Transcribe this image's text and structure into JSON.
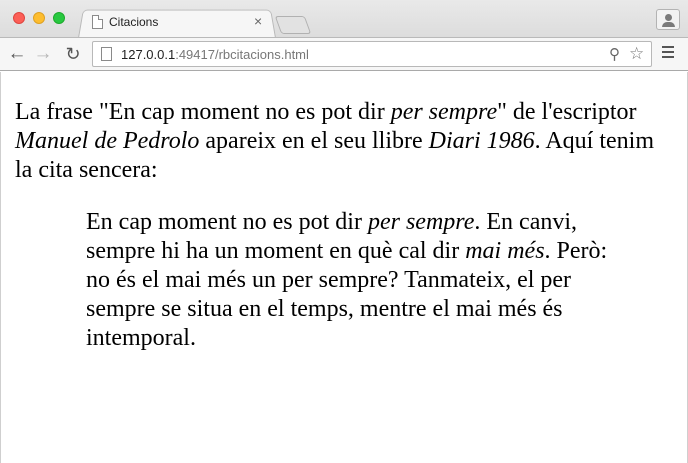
{
  "window": {
    "tab_title": "Citacions",
    "tab_close": "×"
  },
  "toolbar": {
    "back": "←",
    "forward": "→",
    "reload": "↻",
    "url_host": "127.0.0.1",
    "url_rest": ":49417/rbcitacions.html",
    "zoom_icon": "⚲",
    "star_icon": "☆"
  },
  "page": {
    "intro": {
      "part1": "La frase \"En cap moment no es pot dir ",
      "em1": "per sempre",
      "part2": "\" de l'escriptor ",
      "em2": "Manuel de Pedrolo",
      "part3": " apareix en el seu llibre ",
      "em3": "Diari 1986",
      "part4": ". Aquí tenim la cita sencera:"
    },
    "quote": {
      "part1": "En cap moment no es pot dir ",
      "em1": "per sempre",
      "part2": ". En canvi, sempre hi ha un moment en què cal dir ",
      "em2": "mai més",
      "part3": ". Però: no és el mai més un per sempre? Tanmateix, el per sempre se situa en el temps, mentre el mai més és intemporal."
    }
  }
}
